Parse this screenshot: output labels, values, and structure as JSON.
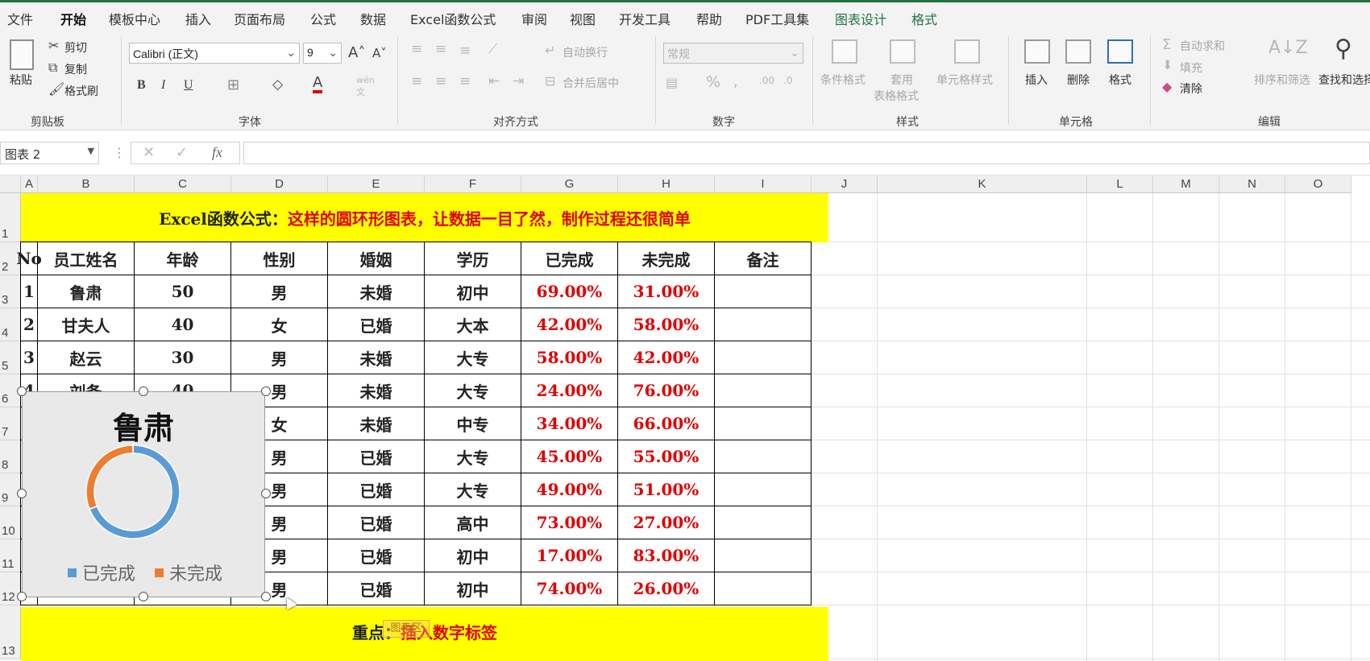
{
  "menu": {
    "tabs": [
      {
        "label": "文件",
        "state": "normal"
      },
      {
        "label": "开始",
        "state": "active"
      },
      {
        "label": "模板中心",
        "state": "normal"
      },
      {
        "label": "插入",
        "state": "normal"
      },
      {
        "label": "页面布局",
        "state": "normal"
      },
      {
        "label": "公式",
        "state": "normal"
      },
      {
        "label": "数据",
        "state": "normal"
      },
      {
        "label": "Excel函数公式",
        "state": "normal"
      },
      {
        "label": "审阅",
        "state": "normal"
      },
      {
        "label": "视图",
        "state": "normal"
      },
      {
        "label": "开发工具",
        "state": "normal"
      },
      {
        "label": "帮助",
        "state": "normal"
      },
      {
        "label": "PDF工具集",
        "state": "normal"
      },
      {
        "label": "图表设计",
        "state": "contextual"
      },
      {
        "label": "格式",
        "state": "contextual"
      }
    ]
  },
  "ribbon": {
    "clipboard": {
      "paste": "粘贴",
      "cut": "剪切",
      "copy": "复制",
      "format_painter": "格式刷",
      "group": "剪贴板"
    },
    "font": {
      "name": "Calibri (正文)",
      "size": "9",
      "group": "字体"
    },
    "alignment": {
      "wrap": "自动换行",
      "merge": "合并后居中",
      "group": "对齐方式"
    },
    "number": {
      "format": "常规",
      "group": "数字"
    },
    "styles": {
      "conditional": "条件格式",
      "table_format_1": "套用",
      "table_format_2": "表格格式",
      "cell_styles": "单元格样式",
      "group": "样式"
    },
    "cells": {
      "insert": "插入",
      "delete": "删除",
      "format": "格式",
      "group": "单元格"
    },
    "editing": {
      "autosum": "自动求和",
      "fill": "填充",
      "clear": "清除",
      "sort": "排序和筛选",
      "find": "查找和选择",
      "group": "编辑"
    }
  },
  "formula_bar": {
    "name_box": "图表 2",
    "formula": ""
  },
  "columns": [
    "A",
    "B",
    "C",
    "D",
    "E",
    "F",
    "G",
    "H",
    "I",
    "J",
    "K",
    "L",
    "M",
    "N",
    "O"
  ],
  "rows": [
    "1",
    "2",
    "3",
    "4",
    "5",
    "6",
    "7",
    "8",
    "9",
    "10",
    "11",
    "12",
    "13"
  ],
  "sheet": {
    "title_black": "Excel函数公式：",
    "title_red": "这样的圆环形图表，让数据一目了然，制作过程还很简单",
    "headers": [
      "No",
      "员工姓名",
      "年龄",
      "性别",
      "婚姻",
      "学历",
      "已完成",
      "未完成",
      "备注"
    ],
    "data": [
      [
        "1",
        "鲁肃",
        "50",
        "男",
        "未婚",
        "初中",
        "69.00%",
        "31.00%",
        ""
      ],
      [
        "2",
        "甘夫人",
        "40",
        "女",
        "已婚",
        "大本",
        "42.00%",
        "58.00%",
        ""
      ],
      [
        "3",
        "赵云",
        "30",
        "男",
        "未婚",
        "大专",
        "58.00%",
        "42.00%",
        ""
      ],
      [
        "4",
        "刘备",
        "40",
        "男",
        "未婚",
        "大专",
        "24.00%",
        "76.00%",
        ""
      ],
      [
        "",
        "",
        "",
        "女",
        "未婚",
        "中专",
        "34.00%",
        "66.00%",
        ""
      ],
      [
        "",
        "",
        "",
        "男",
        "已婚",
        "大专",
        "45.00%",
        "55.00%",
        ""
      ],
      [
        "",
        "",
        "",
        "男",
        "已婚",
        "大专",
        "49.00%",
        "51.00%",
        ""
      ],
      [
        "",
        "",
        "",
        "男",
        "已婚",
        "高中",
        "73.00%",
        "27.00%",
        ""
      ],
      [
        "",
        "",
        "",
        "男",
        "已婚",
        "初中",
        "17.00%",
        "83.00%",
        ""
      ],
      [
        "",
        "",
        "",
        "男",
        "已婚",
        "初中",
        "74.00%",
        "26.00%",
        ""
      ]
    ],
    "footer_black": "重点：",
    "footer_red": "插入数字标签",
    "tooltip": "图表区"
  },
  "chart_data": {
    "type": "pie",
    "variant": "doughnut",
    "title": "鲁肃",
    "categories": [
      "已完成",
      "未完成"
    ],
    "values": [
      0.69,
      0.31
    ],
    "colors": [
      "#5b9bd5",
      "#ed7d31"
    ],
    "legend_position": "bottom"
  }
}
